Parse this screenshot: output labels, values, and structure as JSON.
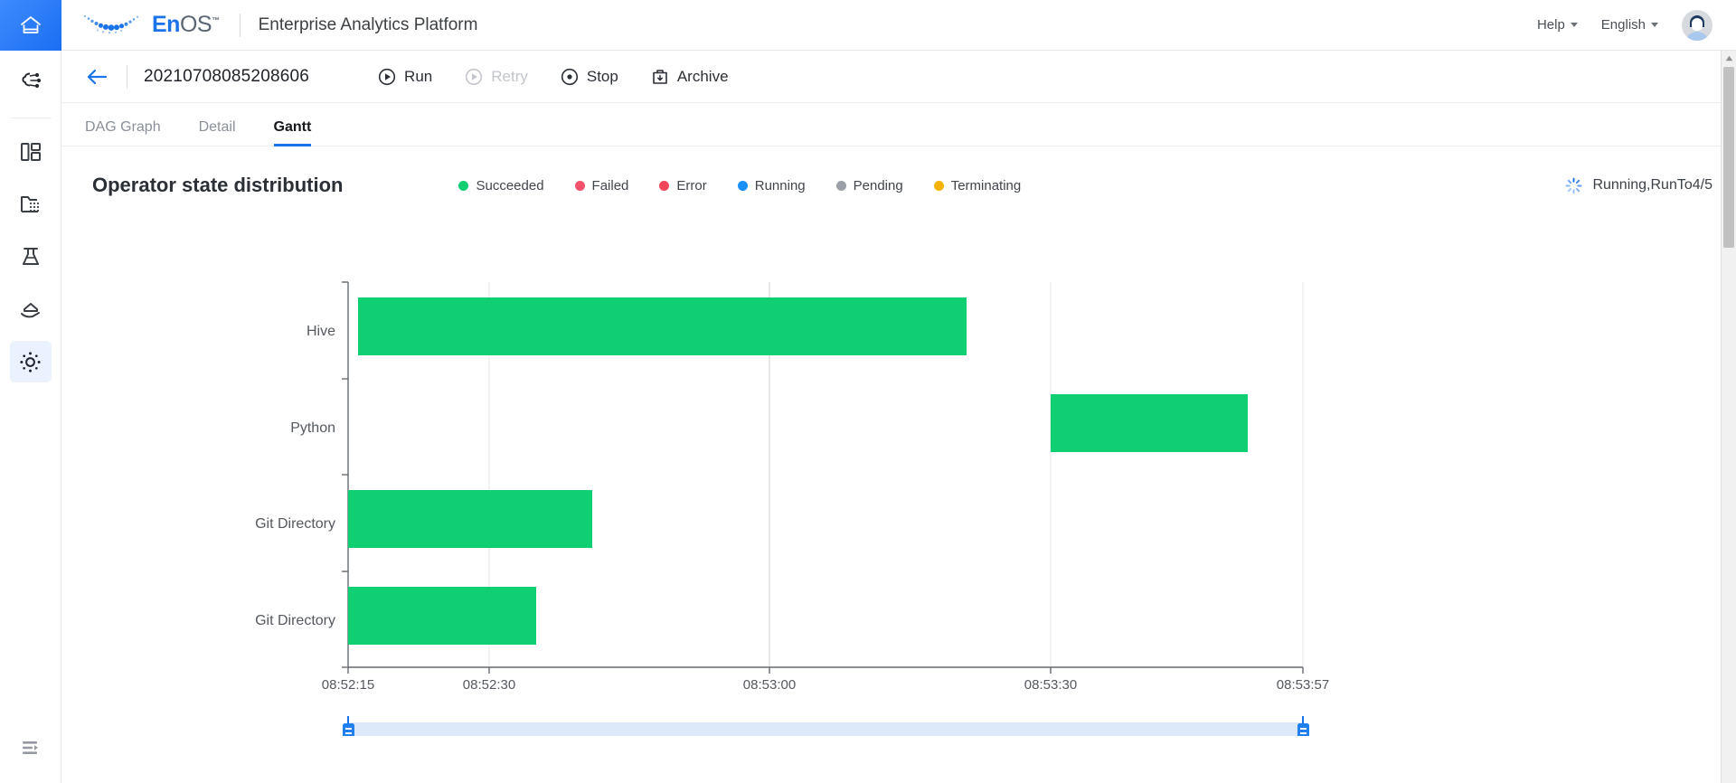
{
  "header": {
    "home_icon": "home-icon",
    "logo_en": "En",
    "logo_os": "OS",
    "logo_tm": "™",
    "platform_title": "Enterprise Analytics Platform",
    "help_label": "Help",
    "language_label": "English",
    "avatar": "user-avatar"
  },
  "sidebar": {
    "items": [
      {
        "name": "ai-model-icon",
        "active": false
      },
      {
        "name": "dashboard-icon",
        "active": false
      },
      {
        "name": "data-folder-icon",
        "active": false
      },
      {
        "name": "lab-flask-icon",
        "active": false
      },
      {
        "name": "model-serving-icon",
        "active": false
      },
      {
        "name": "settings-gear-icon",
        "active": true
      }
    ],
    "collapse_icon": "collapse-sidebar-icon"
  },
  "toolbar": {
    "back_icon": "back-arrow-icon",
    "run_id": "20210708085208606",
    "actions": [
      {
        "label": "Run",
        "icon": "play-circle-icon",
        "disabled": false
      },
      {
        "label": "Retry",
        "icon": "retry-circle-icon",
        "disabled": true
      },
      {
        "label": "Stop",
        "icon": "stop-circle-icon",
        "disabled": false
      },
      {
        "label": "Archive",
        "icon": "archive-box-icon",
        "disabled": false
      }
    ]
  },
  "tabs": [
    {
      "label": "DAG Graph",
      "active": false
    },
    {
      "label": "Detail",
      "active": false
    },
    {
      "label": "Gantt",
      "active": true
    }
  ],
  "panel": {
    "title": "Operator state distribution",
    "status_text": "Running,RunTo4/5",
    "status_icon": "loading-spinner-icon"
  },
  "chart_data": {
    "type": "bar",
    "orientation": "horizontal",
    "title": "Operator state distribution",
    "xlabel": "",
    "ylabel": "",
    "grid": true,
    "legend_position": "top",
    "legend": [
      {
        "label": "Succeeded",
        "color": "#10CE72"
      },
      {
        "label": "Failed",
        "color": "#F4516C"
      },
      {
        "label": "Error",
        "color": "#F4455A"
      },
      {
        "label": "Running",
        "color": "#1890FF"
      },
      {
        "label": "Pending",
        "color": "#9B9FA8"
      },
      {
        "label": "Terminating",
        "color": "#F5B301"
      }
    ],
    "categories": [
      "Hive",
      "Python",
      "Git Directory",
      "Git Directory"
    ],
    "x_tick_labels": [
      "08:52:15",
      "08:52:30",
      "08:53:00",
      "08:53:30",
      "08:53:57"
    ],
    "x_tick_positions": [
      0,
      15,
      45,
      75,
      102
    ],
    "xlim": [
      0,
      102
    ],
    "x_axis_start_time": "08:52:15",
    "x_axis_end_time": "08:53:57",
    "bars": [
      {
        "category": "Hive",
        "state": "Succeeded",
        "color": "#10CE72",
        "start": 0,
        "end": 64,
        "start_time": "08:52:15",
        "end_time": "08:53:19"
      },
      {
        "category": "Python",
        "state": "Succeeded",
        "color": "#10CE72",
        "start": 73,
        "end": 94,
        "start_time": "08:53:28",
        "end_time": "08:53:49"
      },
      {
        "category": "Git Directory",
        "state": "Succeeded",
        "color": "#10CE72",
        "start": 0,
        "end": 25,
        "start_time": "08:52:15",
        "end_time": "08:52:40"
      },
      {
        "category": "Git Directory",
        "state": "Succeeded",
        "color": "#10CE72",
        "start": 0,
        "end": 19,
        "start_time": "08:52:15",
        "end_time": "08:52:34"
      }
    ],
    "data_zoom": {
      "start_percent": 0,
      "end_percent": 100
    }
  },
  "scrollbar": {
    "up_arrow": "scroll-up-arrow-icon"
  }
}
